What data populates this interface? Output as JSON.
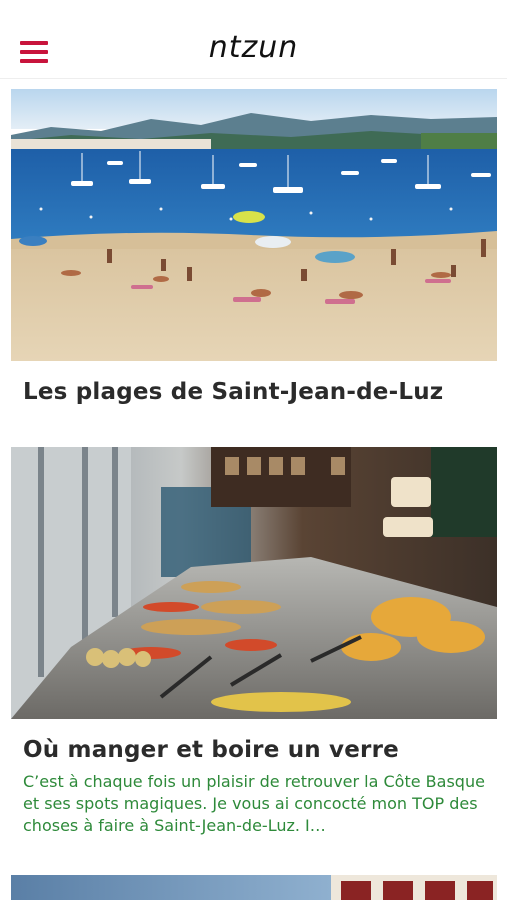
{
  "header": {
    "logo": "ntzun",
    "menu_icon": "hamburger-menu-icon",
    "accent_color": "#c8143c"
  },
  "articles": [
    {
      "title": "Les plages de Saint-Jean-de-Luz",
      "image": "beach-photo"
    },
    {
      "title": "Où manger et boire un verre",
      "excerpt": "C’est à chaque fois un plaisir de retrouver la Côte Basque et ses spots magiques. Je vous ai concocté mon TOP des choses à faire à Saint-Jean-de-Luz. I…",
      "excerpt_color": "#2e8a3a",
      "image": "market-food-photo"
    },
    {
      "image": "street-building-photo"
    }
  ]
}
